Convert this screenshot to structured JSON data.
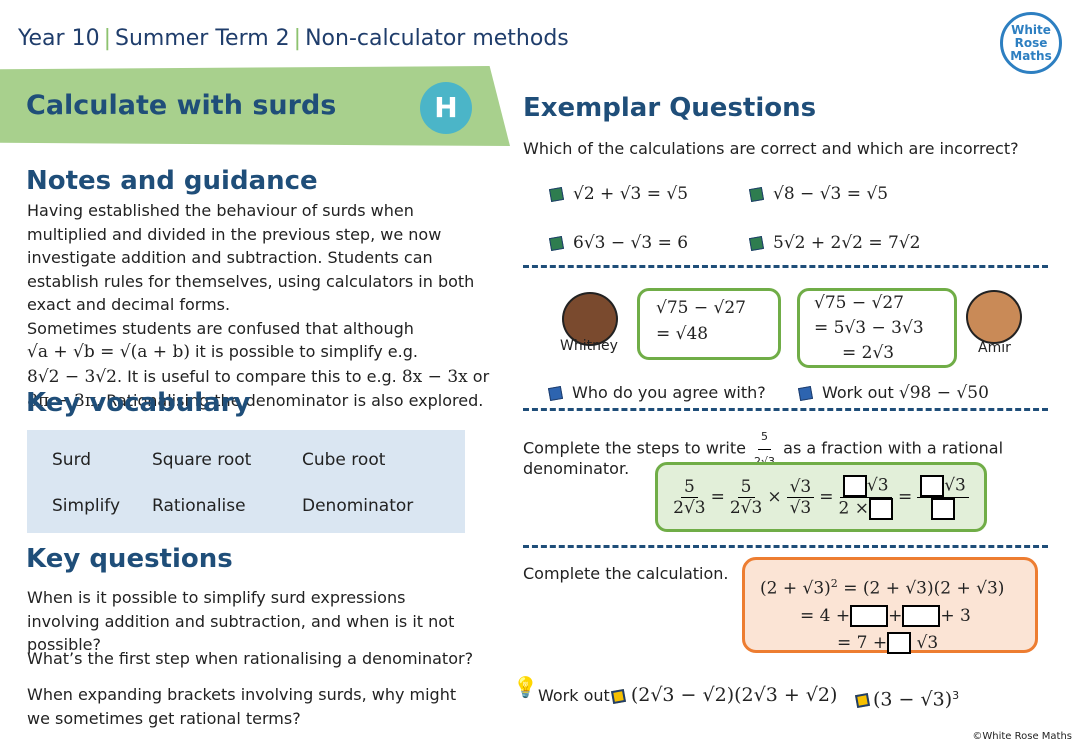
{
  "header": {
    "year": "Year 10",
    "term": "Summer Term 2",
    "unit": "Non-calculator methods"
  },
  "logo": {
    "line1": "White",
    "line2": "Rose",
    "line3": "Maths"
  },
  "banner": {
    "title": "Calculate with surds",
    "tier": "H"
  },
  "notes": {
    "heading": "Notes and guidance",
    "p1": "Having established the behaviour of surds when multiplied and divided in the previous step, we now investigate addition and subtraction. Students can establish rules for themselves, using calculators in both exact and decimal forms.",
    "p2a": "Sometimes students are confused that although ",
    "p2m1": "√a + √b = √(a + b)",
    "p2b": " it is possible to simplify e.g. ",
    "p2m2": "8√2 − 3√2",
    "p2c": ". It is useful to compare this to e.g. ",
    "p2m3": "8x − 3x",
    "p2d": " or ",
    "p2m4": "8π − 3π",
    "p2e": ". Rationalising the denominator is also explored."
  },
  "vocab": {
    "heading": "Key vocabulary",
    "items": [
      "Surd",
      "Square root",
      "Cube root",
      "Simplify",
      "Rationalise",
      "Denominator"
    ]
  },
  "keyq": {
    "heading": "Key questions",
    "items": [
      "When is it possible to simplify surd expressions involving addition and subtraction, and when is it not possible?",
      "What’s the first step when rationalising a denominator?",
      "When expanding brackets involving surds, why might we sometimes get rational terms?"
    ]
  },
  "exemplar": {
    "heading": "Exemplar Questions",
    "intro": "Which of the calculations are correct and which are incorrect?",
    "calcs": [
      "√2 + √3 = √5",
      "√8 − √3 = √5",
      "6√3 − √3 = 6",
      "5√2 + 2√2 = 7√2"
    ],
    "whitney": {
      "name": "Whitney",
      "line1": "√75 − √27",
      "line2": "= √48"
    },
    "amir": {
      "name": "Amir",
      "line1": "√75 − √27",
      "line2": "= 5√3 − 3√3",
      "line3": "= 2√3"
    },
    "q_agree": "Who do you agree with?",
    "q_work": "Work out",
    "q_work_expr": "√98 − √50",
    "rat_text1": "Complete the steps to write",
    "rat_text2": "as a fraction with a rational",
    "rat_text3": "denominator.",
    "rat": {
      "five": "5",
      "den": "2√3",
      "r3": "√3",
      "times": "×",
      "eq": "=",
      "two_x": "2 ×"
    },
    "calc_text": "Complete the calculation.",
    "calc": {
      "l1": "(2 + √3)",
      "sq": "2",
      "l1b": "= (2 + √3)(2 + √3)",
      "l2a": "= 4 +",
      "plus": "+",
      "l2b": "+ 3",
      "l3a": "= 7 +",
      "l3b": "√3"
    },
    "work_out": "Work out",
    "w1": "(2√3 − √2)(2√3 + √2)",
    "w2": "(3 − √3)",
    "w2exp": "3"
  },
  "footer": "©White Rose Maths",
  "colors": {
    "navy": "#1f4e79",
    "green": "#a8d08d",
    "teal": "#4bb5c8",
    "orange": "#ed7d31"
  }
}
